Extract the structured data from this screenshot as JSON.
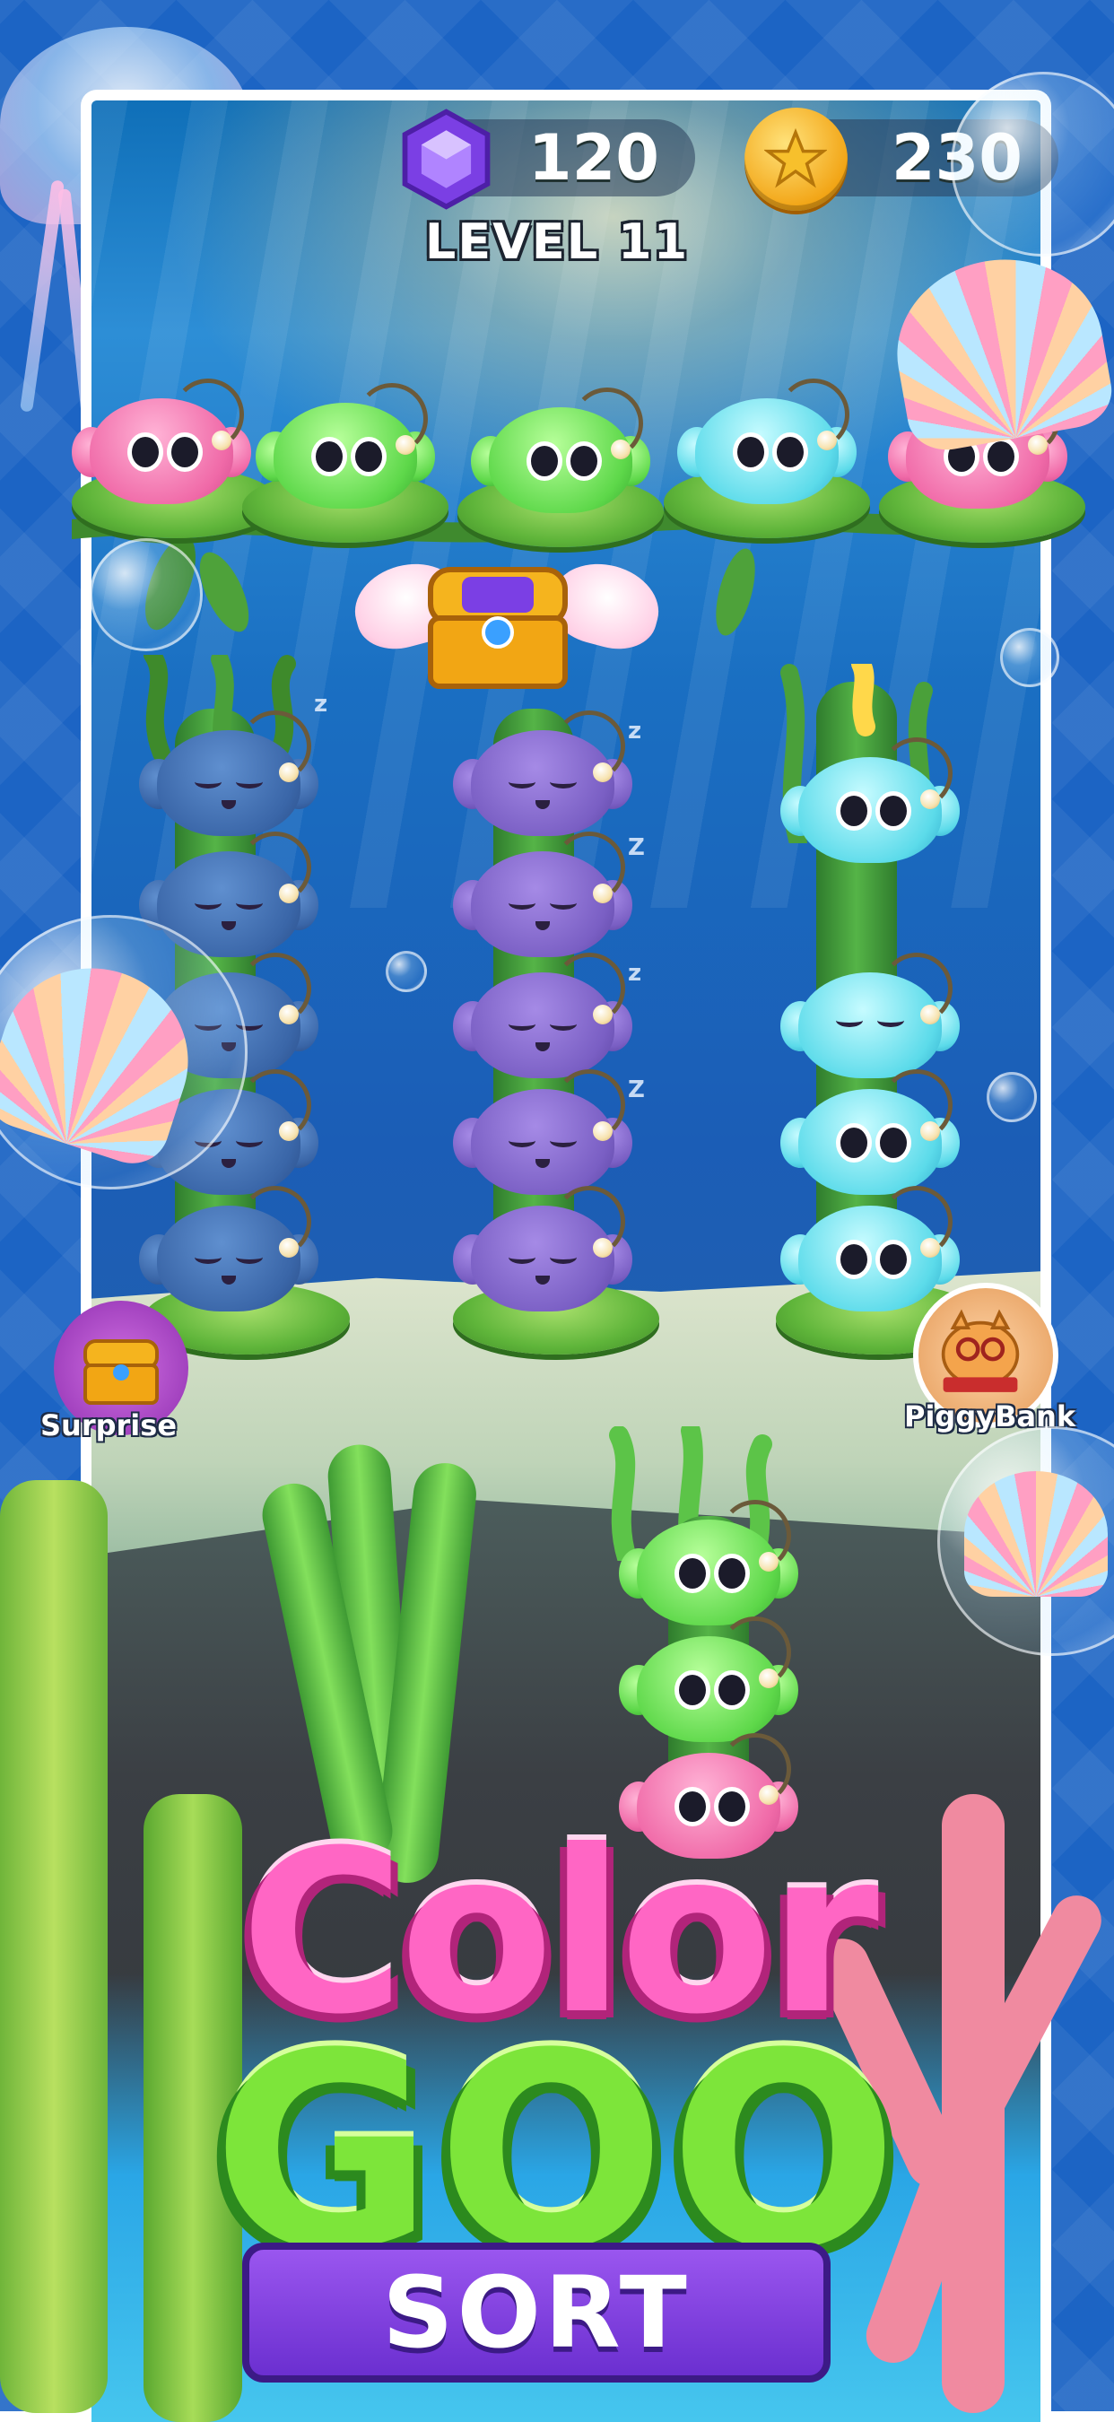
{
  "hud": {
    "gems": "120",
    "coins": "230",
    "level": "LEVEL 11",
    "gem_icon": "purple-gem-icon",
    "coin_icon": "gold-star-coin-icon"
  },
  "buttons": {
    "surprise_label": "Surprise",
    "piggy_label": "PiggyBank"
  },
  "zzz": [
    "z",
    "z",
    "Z",
    "z",
    "Z"
  ],
  "board": {
    "top_shelf": [
      "pink",
      "green",
      "green",
      "cyan",
      "pink"
    ],
    "column_left": [
      "blue",
      "blue",
      "blue",
      "blue",
      "blue"
    ],
    "column_middle": [
      "purple",
      "purple",
      "purple",
      "purple",
      "purple"
    ],
    "column_right": [
      "cyan",
      "cyan",
      "cyan",
      "cyan"
    ],
    "column_bottom": [
      "green",
      "green",
      "pink"
    ],
    "left_sleeping": true,
    "middle_sleeping": true,
    "flying_reward": "treasure-chest-with-wings"
  },
  "logo": {
    "line1": "Color",
    "line2": "GOO",
    "line3": "SORT"
  },
  "colors": {
    "pink": "#f06aa8",
    "green": "#5ed84a",
    "cyan": "#5cdbea",
    "blue": "#3a66a8",
    "purple": "#7a5fc4",
    "frame": "#1c64c4"
  }
}
